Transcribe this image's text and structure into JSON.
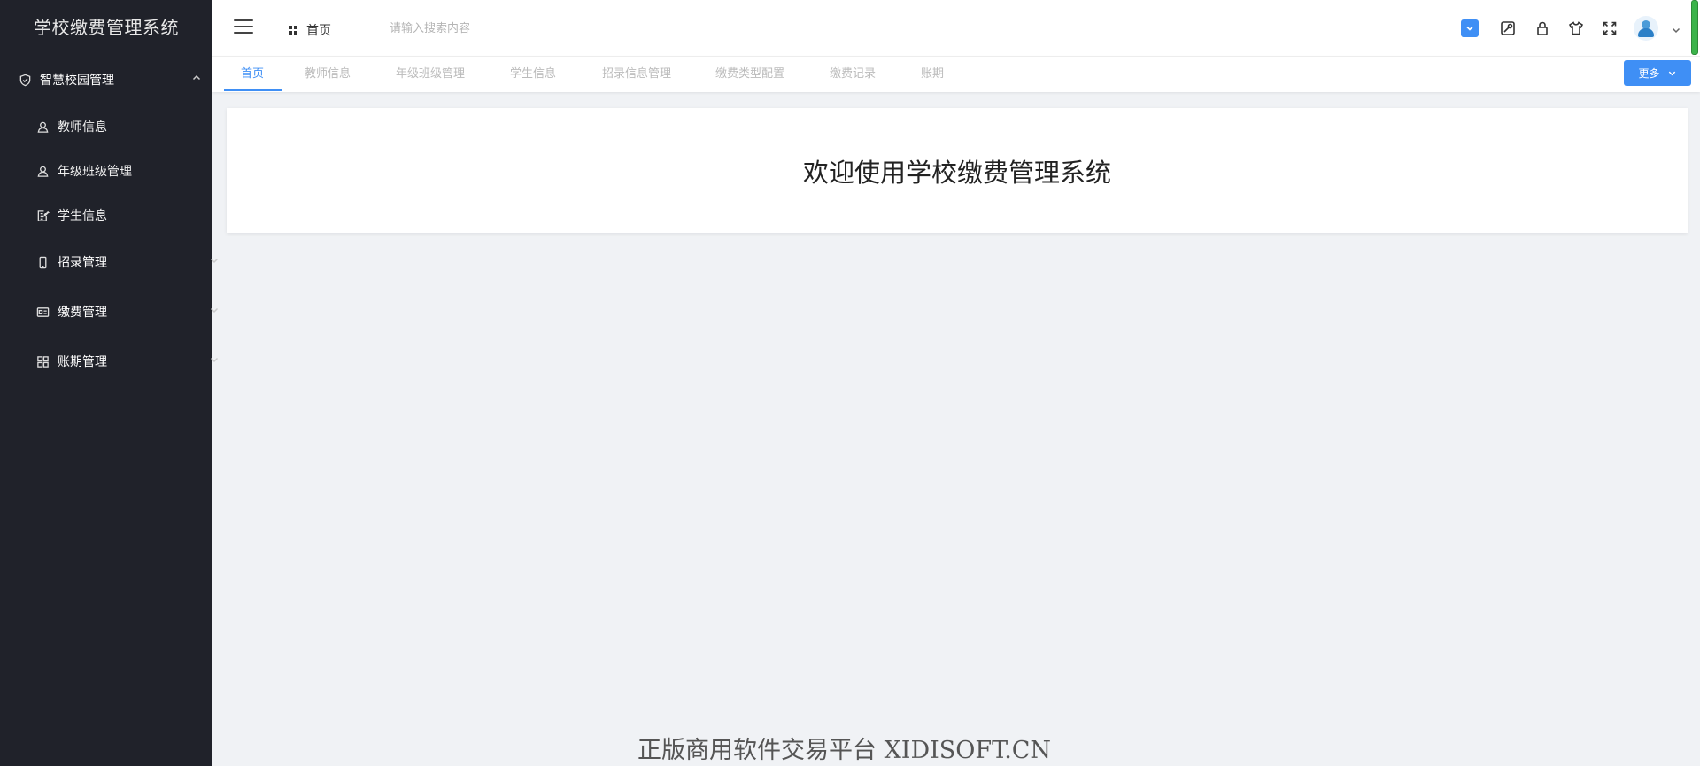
{
  "app": {
    "title": "学校缴费管理系统"
  },
  "sidebar": {
    "groups": [
      {
        "label": "智慧校园管理",
        "icon": "shield-check-icon",
        "expanded": true,
        "children": [
          {
            "label": "教师信息",
            "icon": "user-icon"
          },
          {
            "label": "年级班级管理",
            "icon": "user-icon"
          },
          {
            "label": "学生信息",
            "icon": "edit-doc-icon"
          }
        ]
      },
      {
        "label": "招录管理",
        "icon": "mobile-icon",
        "expanded": false
      },
      {
        "label": "缴费管理",
        "icon": "id-card-icon",
        "expanded": false
      },
      {
        "label": "账期管理",
        "icon": "grid-apps-icon",
        "expanded": false
      }
    ]
  },
  "header": {
    "breadcrumb_home": "首页",
    "search_placeholder": "请输入搜索内容",
    "icons": [
      "dropdown-toggle-icon",
      "tools-icon",
      "lock-icon",
      "theme-shirt-icon",
      "fullscreen-icon",
      "avatar",
      "user-menu-chevron-icon"
    ]
  },
  "tabs": {
    "items": [
      "首页",
      "教师信息",
      "年级班级管理",
      "学生信息",
      "招录信息管理",
      "缴费类型配置",
      "缴费记录",
      "账期"
    ],
    "active_index": 0,
    "more_label": "更多"
  },
  "main": {
    "welcome": "欢迎使用学校缴费管理系统"
  },
  "watermark": "正版商用软件交易平台 XIDISOFT.CN",
  "colors": {
    "accent": "#3f8ff5",
    "sidebar_bg": "#20222a",
    "page_bg": "#f0f2f5"
  }
}
